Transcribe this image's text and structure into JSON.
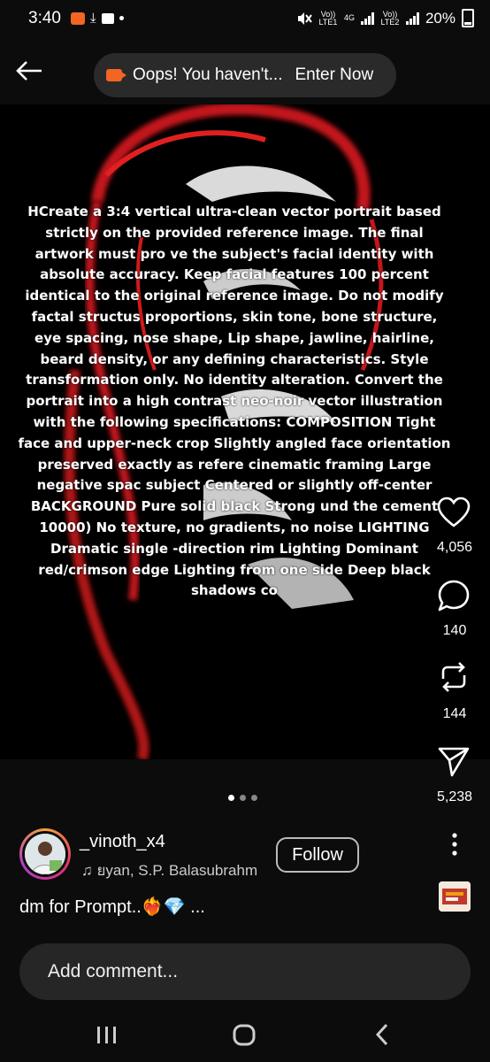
{
  "status_bar": {
    "time": "3:40",
    "sim1": "Vo)) LTE1",
    "sim1_net": "4G",
    "sim2": "Vo)) LTE2",
    "battery": "20%"
  },
  "banner": {
    "text": "Oops! You haven't...",
    "action": "Enter Now"
  },
  "post": {
    "text": "HCreate a 3:4 vertical ultra-clean vector portrait based strictly on the provided reference image. The final artwork must pro ve the subject's facial identity with absolute accuracy. Keep facial features 100 percent identical to the original reference image. Do not modify factal structus proportions, skin tone, bone structure, eye spacing, nose shape, Lip shape, jawline, hairline, beard density, or any defining characteristics. Style transformation only. No identity alteration. Convert the portrait into a high contrast neo-noir vector illustration with the following specifications: COMPOSITION Tight face and upper-neck crop Slightly angled face orientation preserved exactly as refere cinematic framing Large negative spac subject Centered or slightly off-center BACKGROUND Pure solid black Strong und the cement 10000) No texture, no gradients, no noise LIGHTING Dramatic single -direction rim Lighting Dominant red/crimson edge Lighting from one side Deep black shadows co",
    "carousel_total": 3,
    "carousel_active": 0
  },
  "actions": {
    "likes": "4,056",
    "comments": "140",
    "reposts": "144",
    "shares": "5,238"
  },
  "author": {
    "username": "_vinoth_x4",
    "audio": "♫ ยyan, S.P. Balasubrahm",
    "follow_label": "Follow"
  },
  "caption": "dm for Prompt..❤️‍🔥💎 ...",
  "comment": {
    "placeholder": "Add comment..."
  },
  "colors": {
    "accent_orange": "#f26522",
    "background": "#0c0c0c",
    "rim_red": "#c4161c"
  }
}
